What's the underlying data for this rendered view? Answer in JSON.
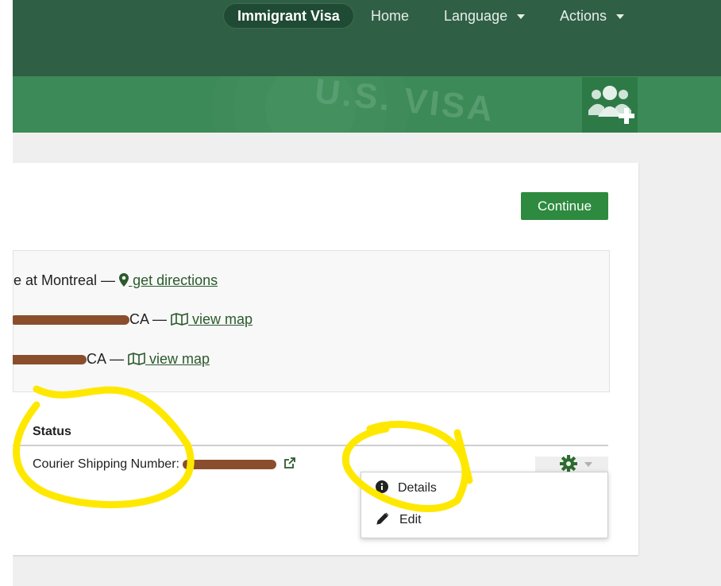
{
  "nav": {
    "brand": "Immigrant Visa",
    "home": "Home",
    "language": "Language",
    "actions": "Actions"
  },
  "banner": {
    "text": "U.S. VISA"
  },
  "card": {
    "continue": "Continue",
    "locations": [
      {
        "text": "e at Montreal — ",
        "link": " get directions",
        "icon": "map-marker-icon"
      },
      {
        "text": "CA — ",
        "link": " view map",
        "icon": "map-icon"
      },
      {
        "text": "CA — ",
        "link": " view map",
        "icon": "map-icon"
      }
    ],
    "status_header": "Status",
    "status_value": "Courier Shipping Number:",
    "menu": {
      "details": "Details",
      "edit": "Edit"
    }
  },
  "colors": {
    "nav_bg": "#2f5f45",
    "banner_bg": "#3c8a58",
    "continue_bg": "#2d8a3f",
    "link": "#2b5a2d",
    "annotation": "#ffe800",
    "redaction": "#8a4e2c"
  }
}
